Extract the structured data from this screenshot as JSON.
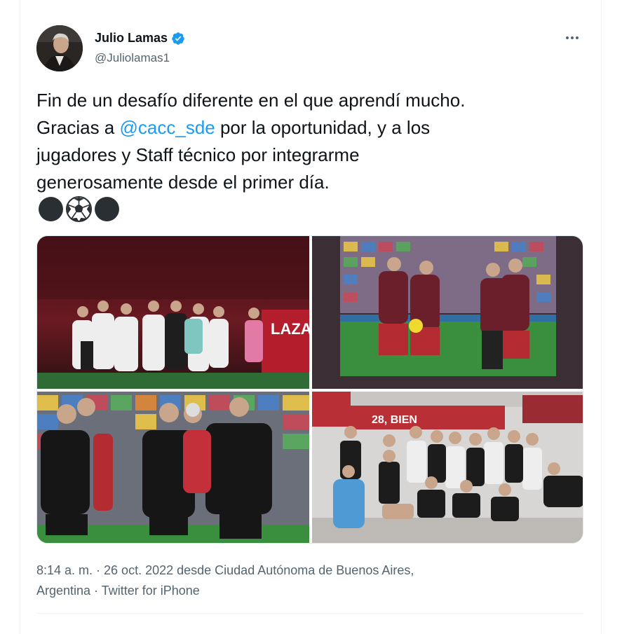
{
  "author": {
    "name": "Julio Lamas",
    "handle": "@Juliolamas1",
    "verified": true
  },
  "tweet": {
    "line1": "Fin de un desafío diferente en el que aprendí mucho.",
    "line2_pre": "Gracias a ",
    "mention": "@cacc_sde",
    "line2_post": " por la oportunidad, y a los",
    "line3": "jugadores y Staff técnico por integrarme",
    "line4": "generosamente desde el primer día.",
    "emojis": [
      "black-circle",
      "soccer-ball",
      "black-circle"
    ]
  },
  "media": [
    {
      "name": "photo-team-huddle",
      "banner_text": "LAZA"
    },
    {
      "name": "photo-coaches-on-pitch"
    },
    {
      "name": "photo-staff-meeting"
    },
    {
      "name": "photo-locker-room-celebration",
      "banner_text": "28, BIEN"
    }
  ],
  "meta": {
    "line1": "8:14 a. m. · 26 oct. 2022 desde Ciudad Autónoma de Buenos Aires,",
    "line2": "Argentina · Twitter for iPhone"
  },
  "colors": {
    "accent": "#1d9bf0",
    "text": "#0f1419",
    "secondary": "#536471"
  }
}
